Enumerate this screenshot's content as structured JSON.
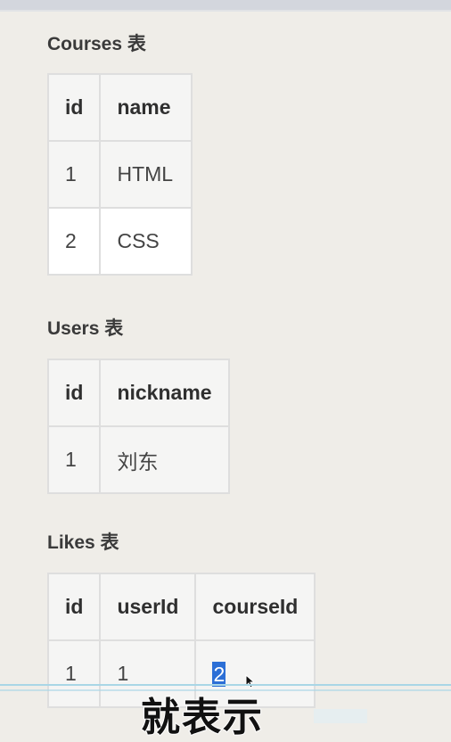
{
  "courses": {
    "title": "Courses 表",
    "headers": [
      "id",
      "name"
    ],
    "rows": [
      [
        "1",
        "HTML"
      ],
      [
        "2",
        "CSS"
      ]
    ]
  },
  "users": {
    "title": "Users 表",
    "headers": [
      "id",
      "nickname"
    ],
    "rows": [
      [
        "1",
        "刘东"
      ]
    ]
  },
  "likes": {
    "title": "Likes 表",
    "headers": [
      "id",
      "userId",
      "courseId"
    ],
    "rows": [
      [
        "1",
        "1",
        "2"
      ]
    ]
  },
  "subtitle": "就表示",
  "colors": {
    "background": "#efede8",
    "selection": "#2c6fd6",
    "table_border": "#dedede"
  }
}
